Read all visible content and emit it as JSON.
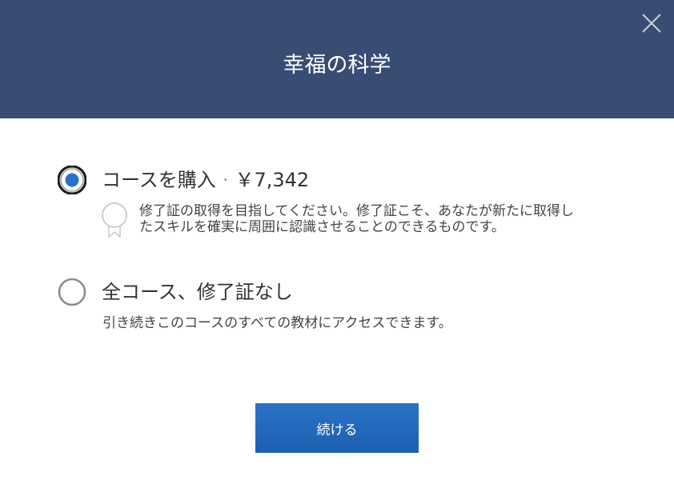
{
  "dialog": {
    "title": "幸福の科学",
    "close_icon": "close-icon"
  },
  "options": [
    {
      "label": "コースを購入",
      "separator": "·",
      "price": "￥7,342",
      "selected": true,
      "icon": "certificate-icon",
      "description": "修了証の取得を目指してください。修了証こそ、あなたが新たに取得したスキルを確実に周囲に認識させることのできるものです。"
    },
    {
      "label": "全コース、修了証なし",
      "selected": false,
      "description": "引き続きこのコースのすべての教材にアクセスできます。"
    }
  ],
  "continue_button": {
    "label": "続ける"
  },
  "colors": {
    "header_bg": "#384c74",
    "accent": "#2a73c6",
    "radio_selected": "#2a72c8"
  }
}
